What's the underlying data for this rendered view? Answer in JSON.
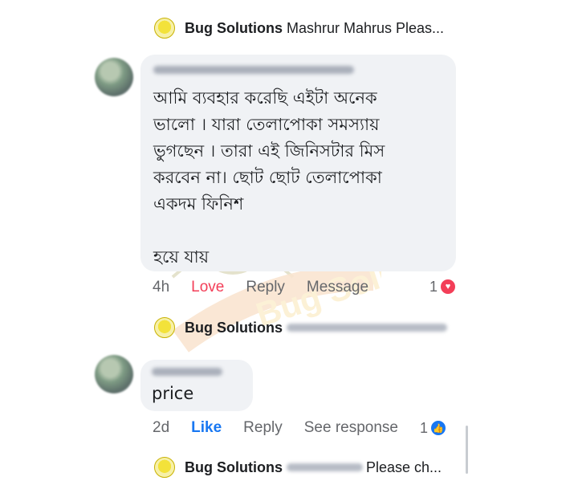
{
  "thread": {
    "top_reply": {
      "name": "Bug Solutions",
      "preview": "Mashrur Mahrus Pleas..."
    },
    "comment1": {
      "text": "আমি ব্যবহার করেছি এইটা অনেক\nভালো । যারা তেলাপোকা সমস্যায়\nভুগছেন । তারা এই জিনিসটার মিস\nকরবেন না।  ছোট ছোট তেলাপোকা\nএকদম ফিনিশ\n\nহয়ে যায়",
      "time": "4h",
      "reaction_label": "Love",
      "reply_label": "Reply",
      "message_label": "Message",
      "reaction_count": "1"
    },
    "reply2": {
      "name": "Bug Solutions"
    },
    "comment2": {
      "text": "price",
      "time": "2d",
      "reaction_label": "Like",
      "reply_label": "Reply",
      "see_response_label": "See response",
      "reaction_count": "1"
    },
    "reply3": {
      "name": "Bug Solutions",
      "preview": "Please ch..."
    }
  },
  "watermark": {
    "text": "Bug Solutions"
  },
  "colors": {
    "love": "#f33e58",
    "like": "#1877f2",
    "bubble": "#f0f2f5",
    "secondary_text": "#65676b"
  },
  "icons": {
    "page_logo": "bug-solutions-logo-icon",
    "love_reaction": "heart-icon",
    "like_reaction": "thumbs-up-icon"
  }
}
